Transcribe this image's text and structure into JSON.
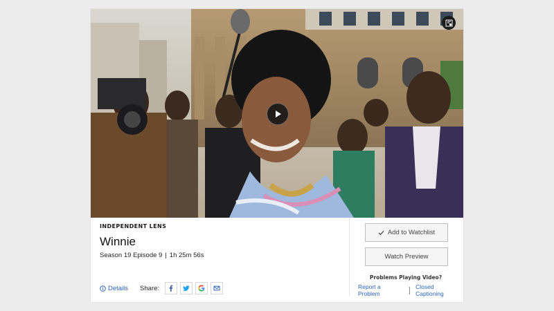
{
  "video": {
    "play_icon": "play-icon",
    "pip_icon": "picture-in-picture-icon"
  },
  "episode": {
    "series": "INDEPENDENT LENS",
    "title": "Winnie",
    "season_episode": "Season 19 Episode 9",
    "separator": "|",
    "duration": "1h 25m 56s"
  },
  "actions": {
    "details_label": "Details",
    "share_label": "Share:",
    "share_icons": [
      "facebook-icon",
      "twitter-icon",
      "google-icon",
      "email-icon"
    ]
  },
  "sidebar": {
    "watchlist_label": "Add to Watchlist",
    "preview_label": "Watch Preview",
    "problems_heading": "Problems Playing Video?",
    "report_link": "Report a Problem",
    "captions_link": "Closed Captioning"
  },
  "colors": {
    "link": "#2b64b8",
    "background": "#ececec",
    "card": "#ffffff",
    "button_bg": "#f5f5f5"
  }
}
